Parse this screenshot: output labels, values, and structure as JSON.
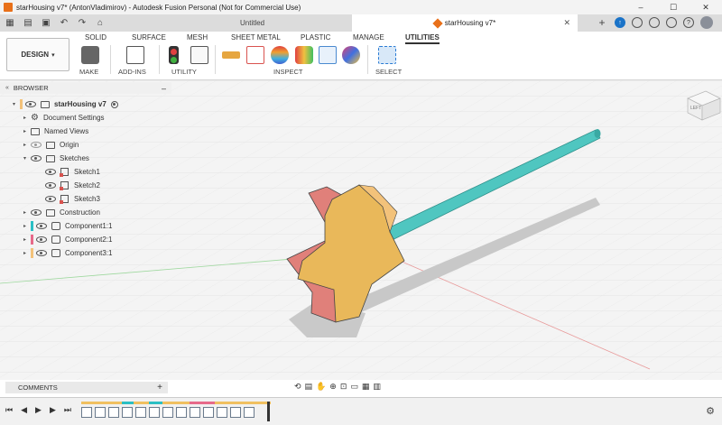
{
  "titlebar": {
    "title": "starHousing v7* (AntonVladimirov) - Autodesk Fusion Personal (Not for Commercial Use)",
    "controls": [
      "–",
      "☐",
      "✕"
    ]
  },
  "tabs": {
    "untitled": "Untitled",
    "active": "starHousing v7*",
    "close": "✕",
    "add": "+"
  },
  "toolbar": {
    "workspace": "DESIGN",
    "workspace_caret": "▾",
    "tabs": [
      "SOLID",
      "SURFACE",
      "MESH",
      "SHEET METAL",
      "PLASTIC",
      "MANAGE",
      "UTILITIES"
    ],
    "active_tab": "UTILITIES",
    "groups": [
      "MAKE",
      "ADD-INS",
      "UTILITY",
      "INSPECT",
      "SELECT"
    ]
  },
  "browser": {
    "title": "BROWSER",
    "collapse": "–",
    "items": [
      {
        "label": "starHousing v7",
        "bold": true
      },
      {
        "label": "Document Settings"
      },
      {
        "label": "Named Views"
      },
      {
        "label": "Origin"
      },
      {
        "label": "Sketches"
      },
      {
        "label": "Sketch1"
      },
      {
        "label": "Sketch2"
      },
      {
        "label": "Sketch3"
      },
      {
        "label": "Construction"
      },
      {
        "label": "Component1:1",
        "color": "#2bbfc4"
      },
      {
        "label": "Component2:1",
        "color": "#e76a8a"
      },
      {
        "label": "Component3:1",
        "color": "#f3c27a"
      }
    ]
  },
  "comments": {
    "title": "COMMENTS",
    "add": "+"
  },
  "viewcube": {
    "label": "LEFT"
  },
  "colors": {
    "accent": "#1a73c8",
    "star_front": "#e9b85a",
    "star_side": "#e0807a",
    "rod": "#4fc6c0"
  }
}
